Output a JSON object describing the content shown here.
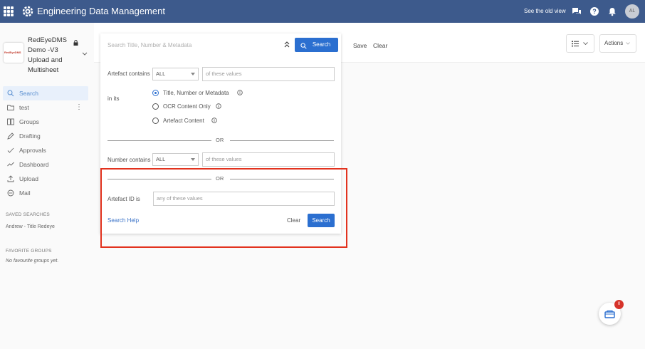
{
  "header": {
    "app_title": "Engineering Data Management",
    "old_view_link": "See the old view",
    "avatar_initials": "AL",
    "bar_color": "#3d5a8c"
  },
  "sidebar": {
    "project_logo_text": "RedEyeDMS",
    "project_name": "RedEyeDMS Demo -V3 Upload and Multisheet",
    "nav": [
      {
        "label": "Search",
        "icon": "search-icon",
        "active": true
      },
      {
        "label": "test",
        "icon": "folder-icon"
      },
      {
        "label": "Groups",
        "icon": "groups-icon"
      },
      {
        "label": "Drafting",
        "icon": "pencil-icon"
      },
      {
        "label": "Approvals",
        "icon": "check-icon"
      },
      {
        "label": "Dashboard",
        "icon": "chart-line-icon"
      },
      {
        "label": "Upload",
        "icon": "upload-icon"
      },
      {
        "label": "Mail",
        "icon": "mail-icon"
      }
    ],
    "saved_searches_label": "SAVED SEARCHES",
    "saved_search_item": "Andrew - Title Redeye",
    "favorite_groups_label": "FAVORITE GROUPS",
    "favorite_groups_empty": "No favourite groups yet."
  },
  "toolbar": {
    "save_label": "Save",
    "clear_label": "Clear",
    "actions_label": "Actions"
  },
  "search": {
    "placeholder": "Search Title, Number & Metadata",
    "search_button": "Search",
    "artefact_contains_label": "Artefact contains",
    "artefact_mode": "ALL",
    "artefact_values_placeholder": "of these values",
    "in_its_label": "in its",
    "radio_options": [
      {
        "label": "Title, Number or Metadata",
        "checked": true
      },
      {
        "label": "OCR Content Only",
        "checked": false
      },
      {
        "label": "Artefact Content",
        "checked": false
      }
    ],
    "or_text": "OR",
    "number_contains_label": "Number contains",
    "number_mode": "ALL",
    "number_values_placeholder": "of these values",
    "artefact_id_label": "Artefact ID is",
    "artefact_id_placeholder": "any of these values",
    "help_link": "Search Help",
    "clear_button": "Clear",
    "search_button_bottom": "Search"
  },
  "basket": {
    "count": "0"
  },
  "colors": {
    "primary": "#2b6fd0",
    "highlight": "#e2321e",
    "badge": "#d6332a"
  }
}
